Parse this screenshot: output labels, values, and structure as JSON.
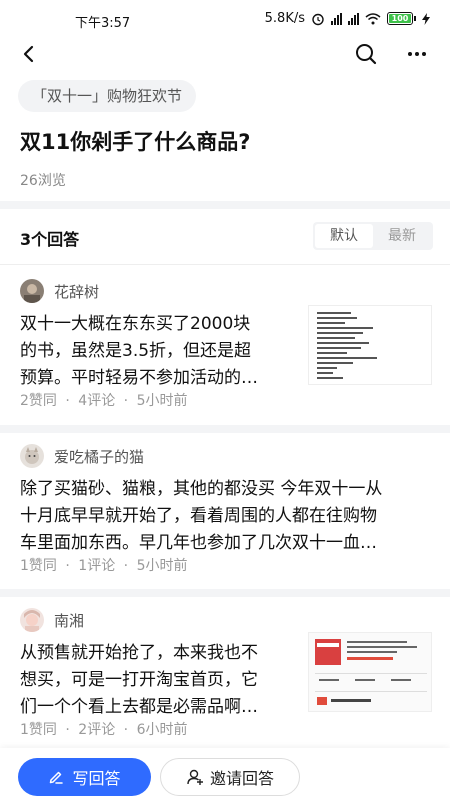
{
  "status_bar": {
    "time": "下午3:57",
    "speed": "5.8K/s",
    "battery": "100"
  },
  "icons": {
    "back": "back-arrow-icon",
    "search": "search-icon",
    "more": "more-icon"
  },
  "question": {
    "topic_tag": "「双十一」购物狂欢节",
    "title": "双11你剁手了什么商品?",
    "views": "26浏览"
  },
  "answers_header": {
    "count_label": "3个回答",
    "sort_default": "默认",
    "sort_latest": "最新"
  },
  "answers": [
    {
      "author": "花辞树",
      "lines": [
        "双十一大概在东东买了2000块",
        "的书，虽然是3.5折，但还是超",
        "预算。平时轻易不参加活动的…"
      ],
      "likes": "2赞同",
      "comments": "4评论",
      "time": "5小时前",
      "sep": "·"
    },
    {
      "author": "爱吃橘子的猫",
      "lines": [
        "除了买猫砂、猫粮，其他的都没买 今年双十一从",
        "十月底早早就开始了，看着周围的人都在往购物",
        "车里面加东西。早几年也参加了几次双十一血…"
      ],
      "likes": "1赞同",
      "comments": "1评论",
      "time": "5小时前",
      "sep": "·"
    },
    {
      "author": "南湘",
      "lines": [
        "从预售就开始抢了，本来我也不",
        "想买，可是一打开淘宝首页，它",
        "们一个个看上去都是必需品啊…"
      ],
      "likes": "1赞同",
      "comments": "2评论",
      "time": "6小时前",
      "sep": "·"
    }
  ],
  "bottom_bar": {
    "write_label": "写回答",
    "invite_label": "邀请回答"
  },
  "colors": {
    "accent": "#2f6bff",
    "battery": "#3ec14a"
  }
}
